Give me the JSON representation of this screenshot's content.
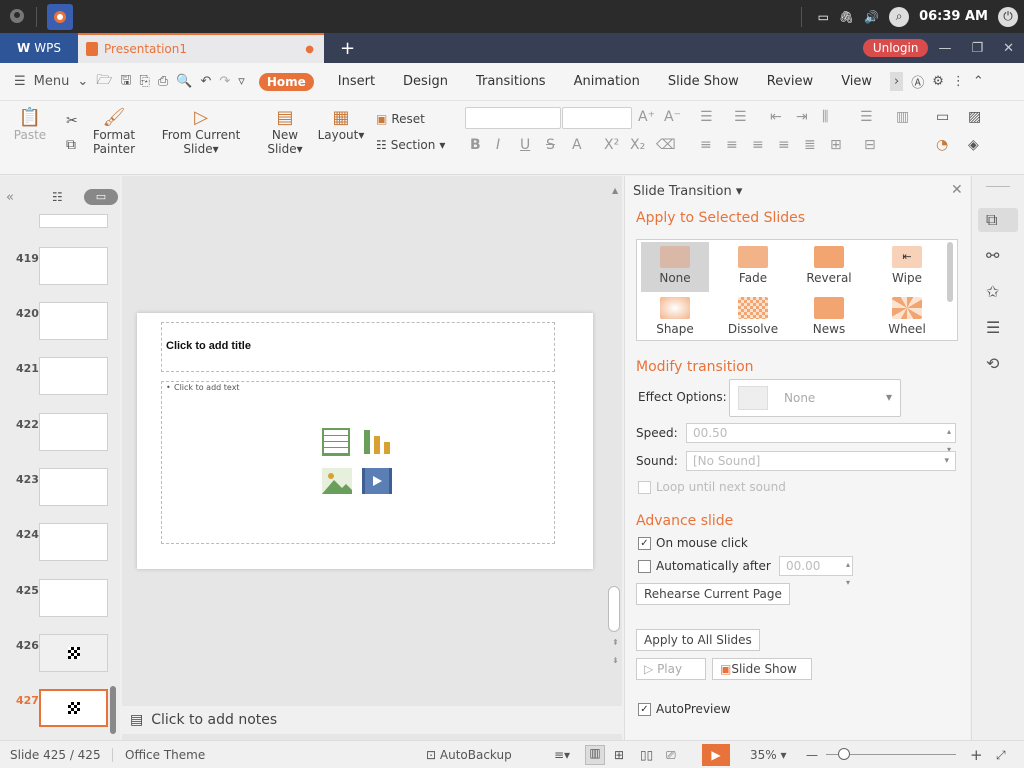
{
  "system": {
    "time": "06:39 AM"
  },
  "tabs": {
    "wps_label": "WPS",
    "doc_title": "Presentation1",
    "unlogin": "Unlogin"
  },
  "menu": {
    "menu_label": "Menu",
    "items": [
      "Home",
      "Insert",
      "Design",
      "Transitions",
      "Animation",
      "Slide Show",
      "Review",
      "View"
    ]
  },
  "ribbon": {
    "paste": "Paste",
    "format_painter_line1": "Format",
    "format_painter_line2": "Painter",
    "from_current_line1": "From Current",
    "from_current_line2": "Slide",
    "new_slide_line1": "New",
    "new_slide_line2": "Slide",
    "layout": "Layout",
    "reset": "Reset",
    "section": "Section"
  },
  "slides_panel": {
    "numbers": [
      "419",
      "420",
      "421",
      "422",
      "423",
      "424",
      "425",
      "426",
      "427"
    ]
  },
  "slide": {
    "title_placeholder": "Click to add title",
    "text_placeholder": "Click to add text"
  },
  "notes": {
    "placeholder": "Click to add notes"
  },
  "transition": {
    "pane_title": "Slide Transition",
    "apply_heading": "Apply to Selected Slides",
    "effects": [
      {
        "name": "None",
        "color": "#d9b8a8"
      },
      {
        "name": "Fade",
        "color": "#f3b389"
      },
      {
        "name": "Reveral",
        "color": "#f3a571"
      },
      {
        "name": "Wipe",
        "color": "#f7d2b8"
      },
      {
        "name": "Shape",
        "color": "#f3b389"
      },
      {
        "name": "Dissolve",
        "color": "#f7c9a8"
      },
      {
        "name": "News",
        "color": "#f3a571"
      },
      {
        "name": "Wheel",
        "color": "#f3a571"
      }
    ],
    "modify_heading": "Modify transition",
    "effect_options_label": "Effect Options:",
    "effect_options_value": "None",
    "speed_label": "Speed:",
    "speed_value": "00.50",
    "sound_label": "Sound:",
    "sound_value": "[No Sound]",
    "loop_label": "Loop until next sound",
    "advance_heading": "Advance slide",
    "on_click_label": "On mouse click",
    "auto_after_label": "Automatically after",
    "auto_after_value": "00.00",
    "rehearse_label": "Rehearse Current Page",
    "apply_all_label": "Apply to All Slides",
    "play_label": "Play",
    "slideshow_label": "Slide Show",
    "autopreview_label": "AutoPreview"
  },
  "status": {
    "slide_count": "Slide 425 / 425",
    "theme": "Office Theme",
    "autobackup": "AutoBackup",
    "zoom": "35%"
  },
  "colors": {
    "accent": "#e8733a",
    "tabbar": "#373f55",
    "wps_blue": "#2d5597"
  }
}
